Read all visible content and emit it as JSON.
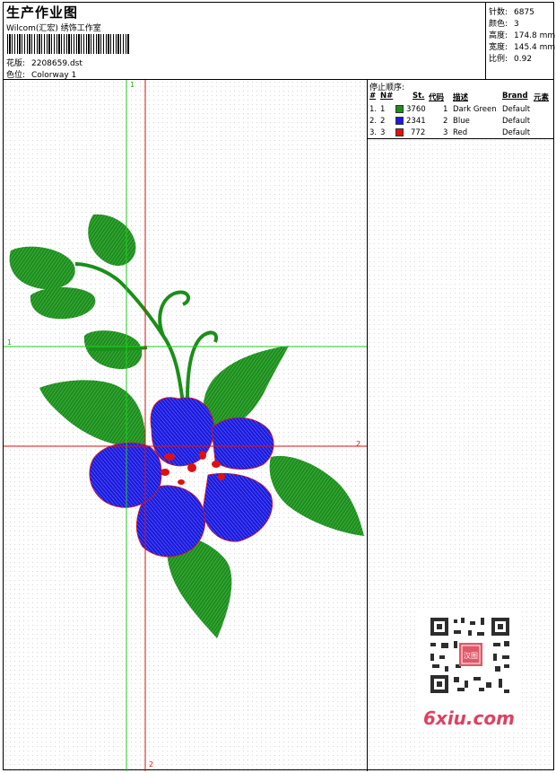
{
  "header": {
    "title": "生产作业图",
    "subtitle": "Wilcom(汇宏) 绣饰工作室",
    "design_label": "花版:",
    "design_value": "2208659.dst",
    "colorway_label": "色位:",
    "colorway_value": "Colorway 1"
  },
  "stats": [
    {
      "label": "针数:",
      "value": "6875"
    },
    {
      "label": "颜色:",
      "value": "3"
    },
    {
      "label": "高度:",
      "value": "174.8 mm"
    },
    {
      "label": "宽度:",
      "value": "145.4 mm"
    },
    {
      "label": "比例:",
      "value": "0.92"
    }
  ],
  "stop_sequence": {
    "title": "停止顺序:",
    "columns": [
      "#",
      "N#",
      "St.",
      "代码",
      "描述",
      "Brand",
      "元素"
    ],
    "rows": [
      {
        "n": "1.",
        "num": "1",
        "color": "#1a8f1a",
        "stitches": "3760",
        "code": "1",
        "desc": "Dark Green",
        "brand": "Default"
      },
      {
        "n": "2.",
        "num": "2",
        "color": "#1a1ae0",
        "stitches": "2341",
        "code": "2",
        "desc": "Blue",
        "brand": "Default"
      },
      {
        "n": "3.",
        "num": "3",
        "color": "#e01010",
        "stitches": "772",
        "code": "3",
        "desc": "Red",
        "brand": "Default"
      }
    ]
  },
  "axes": {
    "green_top": "1",
    "green_left": "1",
    "red_right": "2",
    "red_bottom": "2"
  },
  "watermark": {
    "text": "6xiu.com",
    "stamp": "汉图"
  },
  "colors": {
    "green": "#1a8f1a",
    "blue": "#1a1ae0",
    "red": "#e01010"
  }
}
